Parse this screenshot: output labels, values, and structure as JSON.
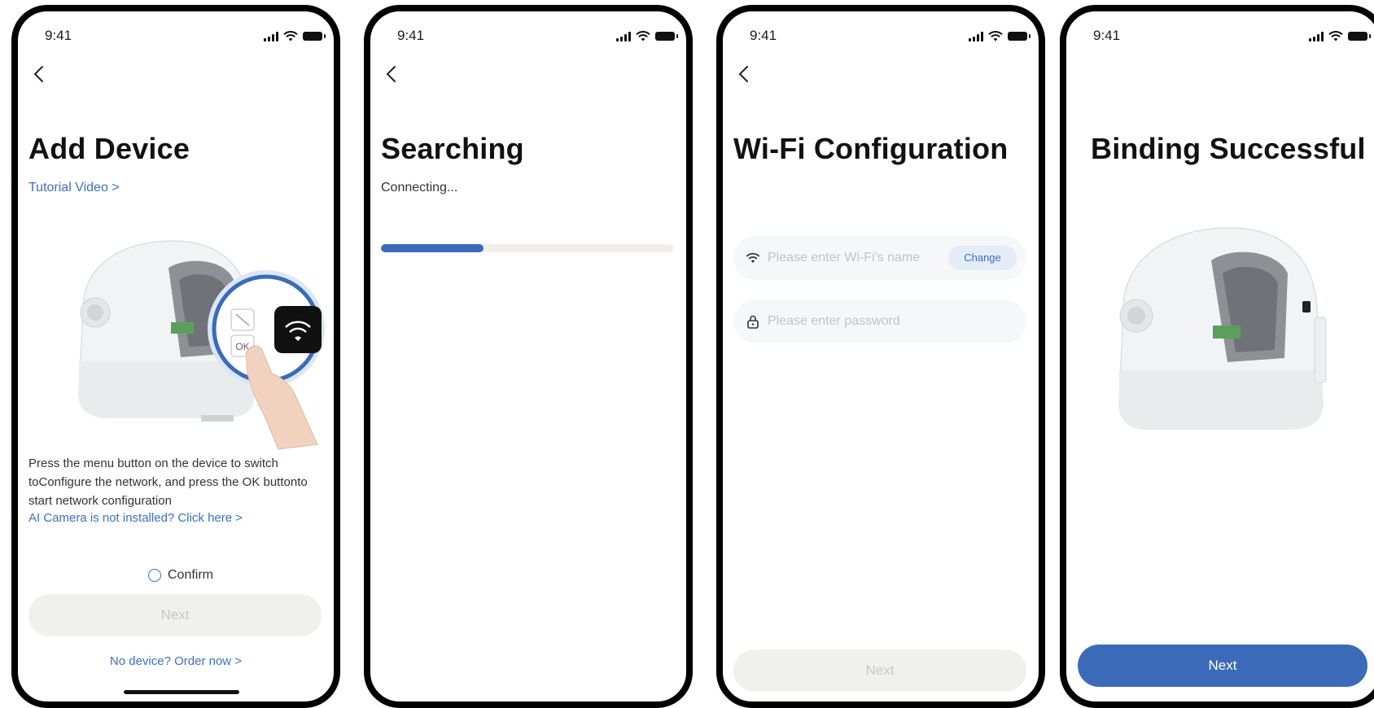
{
  "status_time": "9:41",
  "screen1": {
    "title": "Add Device",
    "tutorial_link": "Tutorial Video >",
    "device_button_label": "OK",
    "description": "Press the menu button on the device to switch toConfigure the network, and press the OK buttonto start network configuration",
    "not_installed_link": "AI Camera is not installed? Click here >",
    "confirm_label": "Confirm",
    "next_label": "Next",
    "order_link": "No device? Order now >"
  },
  "screen2": {
    "title": "Searching",
    "status": "Connecting...",
    "progress_fraction": 0.35
  },
  "screen3": {
    "title": "Wi-Fi Configuration",
    "wifi_placeholder": "Please enter Wi-Fi's name",
    "change_label": "Change",
    "password_placeholder": "Please enter password",
    "next_label": "Next"
  },
  "screen4": {
    "title": "Binding Successful",
    "next_label": "Next"
  },
  "colors": {
    "accent_blue": "#3b6bb8",
    "link_blue": "#3b6fc3",
    "disabled_bg": "#f0f0ee",
    "disabled_text": "#c7c7c7"
  },
  "icons": [
    "signal-icon",
    "wifi-icon",
    "battery-icon",
    "back-chevron-icon",
    "lock-icon",
    "radio-icon"
  ]
}
